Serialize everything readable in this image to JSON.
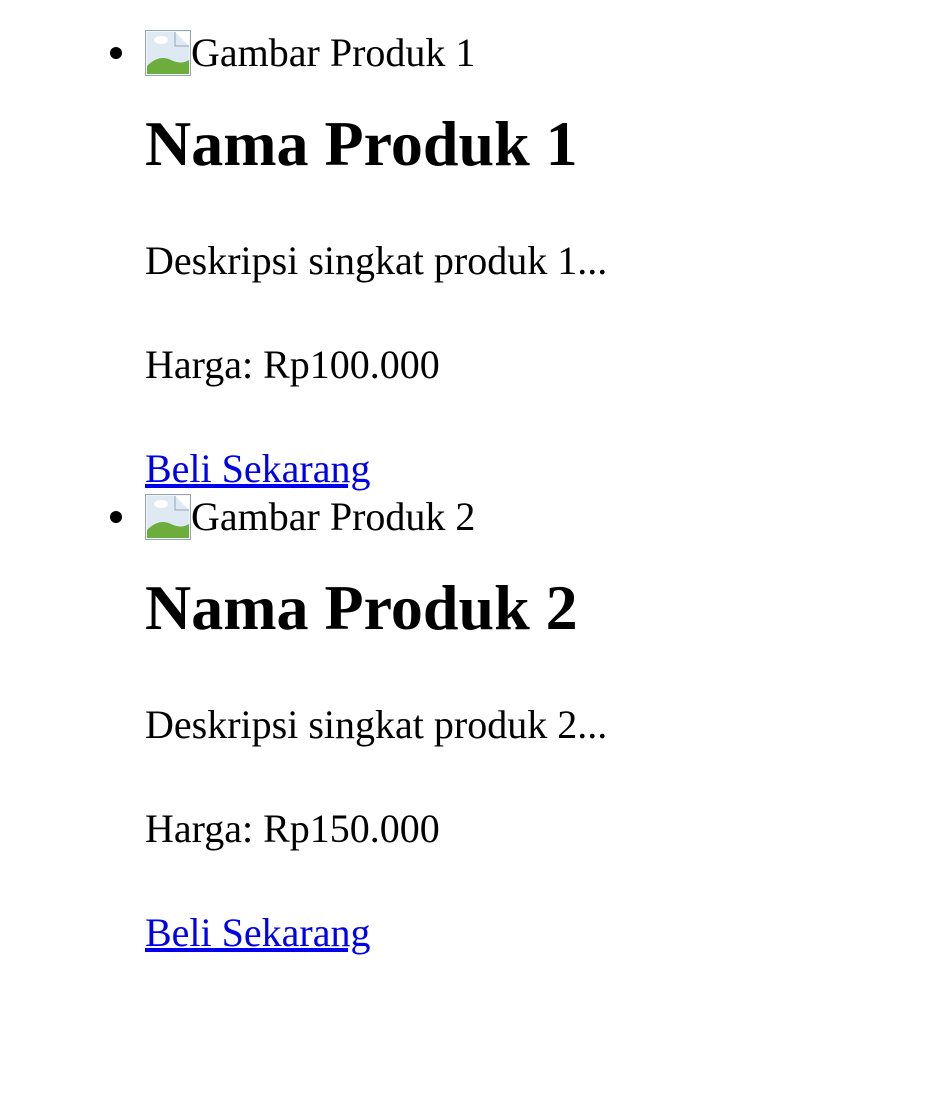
{
  "products": [
    {
      "image_alt": "Gambar Produk 1",
      "name": "Nama Produk 1",
      "description": "Deskripsi singkat produk 1...",
      "price": "Harga: Rp100.000",
      "buy_label": "Beli Sekarang"
    },
    {
      "image_alt": "Gambar Produk 2",
      "name": "Nama Produk 2",
      "description": "Deskripsi singkat produk 2...",
      "price": "Harga: Rp150.000",
      "buy_label": "Beli Sekarang"
    }
  ],
  "icons": {
    "image_placeholder": "broken-image-icon"
  }
}
